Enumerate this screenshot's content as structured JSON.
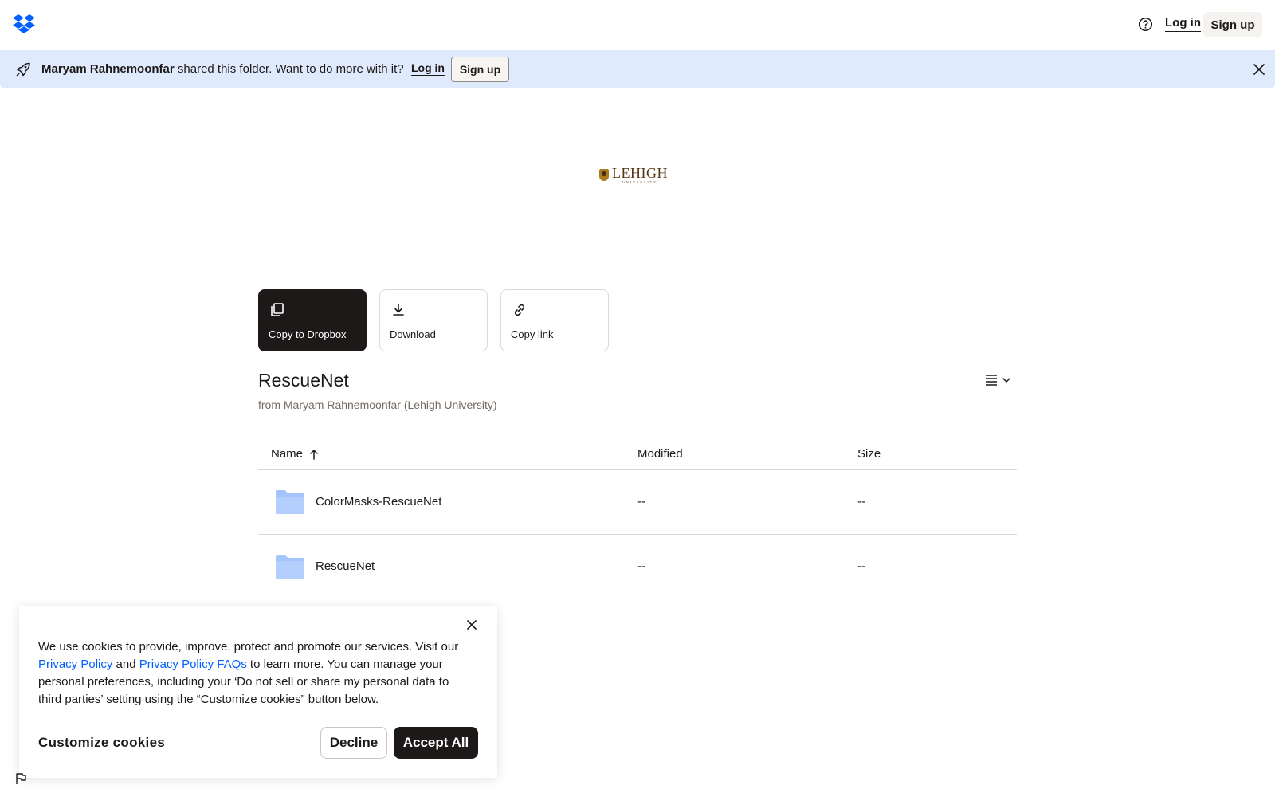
{
  "header": {
    "help_icon": "help-circle-icon",
    "login_label": "Log in",
    "signup_label": "Sign up"
  },
  "banner": {
    "owner": "Maryam Rahnemoonfar",
    "message": " shared this folder. Want to do more with it?",
    "login_label": "Log in",
    "signup_label": "Sign up"
  },
  "actions": [
    {
      "label": "Copy to Dropbox",
      "icon": "copy-icon"
    },
    {
      "label": "Download",
      "icon": "download-icon"
    },
    {
      "label": "Copy link",
      "icon": "link-icon"
    }
  ],
  "logo": {
    "name": "LEHIGH",
    "sub": "UNIVERSITY"
  },
  "folder": {
    "title": "RescueNet",
    "subtitle": "from Maryam Rahnemoonfar (Lehigh University)"
  },
  "table": {
    "headers": {
      "name": "Name",
      "modified": "Modified",
      "size": "Size"
    },
    "rows": [
      {
        "name": "ColorMasks-RescueNet",
        "modified": "--",
        "size": "--"
      },
      {
        "name": "RescueNet",
        "modified": "--",
        "size": "--"
      }
    ]
  },
  "cookie": {
    "text_1": "We use cookies to provide, improve, protect and promote our services. Visit our ",
    "privacy_policy": "Privacy Policy",
    "text_2": " and ",
    "privacy_faqs": "Privacy Policy FAQs",
    "text_3": " to learn more. You can manage your personal preferences, including your ‘Do not sell or share my personal data to third parties’ setting using the “Customize cookies” button below.",
    "customize_label": "Customize cookies",
    "decline_label": "Decline",
    "accept_label": "Accept All"
  },
  "colors": {
    "accent": "#0061fe",
    "banner_bg": "#dfeafd",
    "folder": "#a3c4fd",
    "dark": "#1e1919"
  }
}
